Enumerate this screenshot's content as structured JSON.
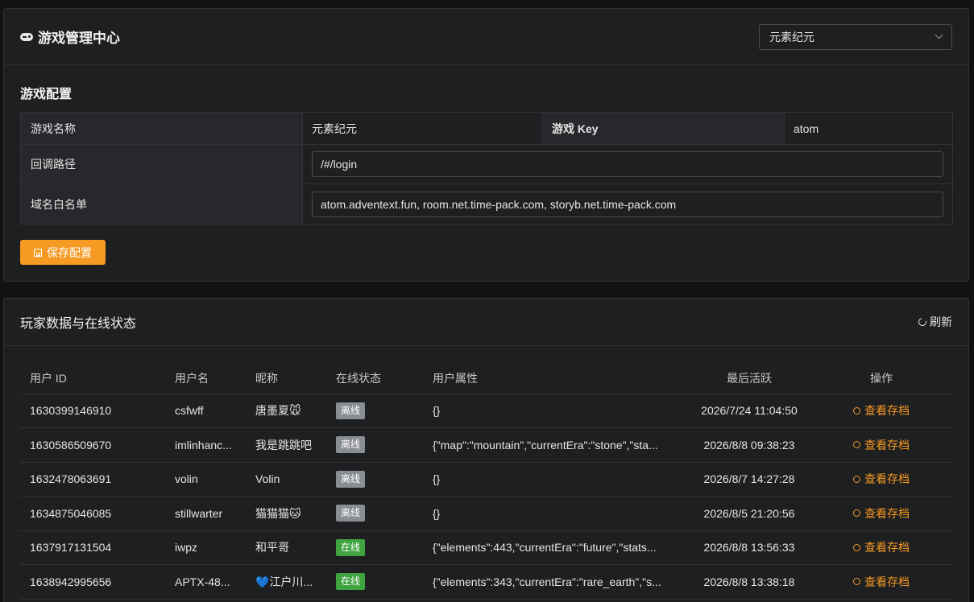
{
  "header": {
    "title": "游戏管理中心",
    "game_select": "元素纪元"
  },
  "config": {
    "section_title": "游戏配置",
    "name_label": "游戏名称",
    "name_value": "元素纪元",
    "key_label": "游戏 Key",
    "key_value": "atom",
    "callback_label": "回调路径",
    "callback_value": "/#/login",
    "whitelist_label": "域名白名单",
    "whitelist_value": "atom.adventext.fun, room.net.time-pack.com, storyb.net.time-pack.com",
    "save_label": "保存配置"
  },
  "players": {
    "title": "玩家数据与在线状态",
    "refresh_label": "刷新",
    "columns": [
      "用户 ID",
      "用户名",
      "昵称",
      "在线状态",
      "用户属性",
      "最后活跃",
      "操作"
    ],
    "rows": [
      {
        "id": "1630399146910",
        "username": "csfwff",
        "nickname": "唐墨夏🐭",
        "status": "离线",
        "online": false,
        "attrs": "{}",
        "last": "2026/7/24 11:04:50",
        "action": "查看存档"
      },
      {
        "id": "1630586509670",
        "username": "imlinhanc...",
        "nickname": "我是跳跳吧",
        "status": "离线",
        "online": false,
        "attrs": "{\"map\":\"mountain\",\"currentEra\":\"stone\",\"sta...",
        "last": "2026/8/8 09:38:23",
        "action": "查看存档"
      },
      {
        "id": "1632478063691",
        "username": "volin",
        "nickname": "Volin",
        "status": "离线",
        "online": false,
        "attrs": "{}",
        "last": "2026/8/7 14:27:28",
        "action": "查看存档"
      },
      {
        "id": "1634875046085",
        "username": "stillwarter",
        "nickname": "猫猫猫🐱",
        "status": "离线",
        "online": false,
        "attrs": "{}",
        "last": "2026/8/5 21:20:56",
        "action": "查看存档"
      },
      {
        "id": "1637917131504",
        "username": "iwpz",
        "nickname": "和平哥",
        "status": "在线",
        "online": true,
        "attrs": "{\"elements\":443,\"currentEra\":\"future\",\"stats...",
        "last": "2026/8/8 13:56:33",
        "action": "查看存档"
      },
      {
        "id": "1638942995656",
        "username": "APTX-48...",
        "nickname": "💙江户川...",
        "status": "在线",
        "online": true,
        "attrs": "{\"elements\":343,\"currentEra\":\"rare_earth\",\"s...",
        "last": "2026/8/8 13:38:18",
        "action": "查看存档"
      }
    ]
  }
}
